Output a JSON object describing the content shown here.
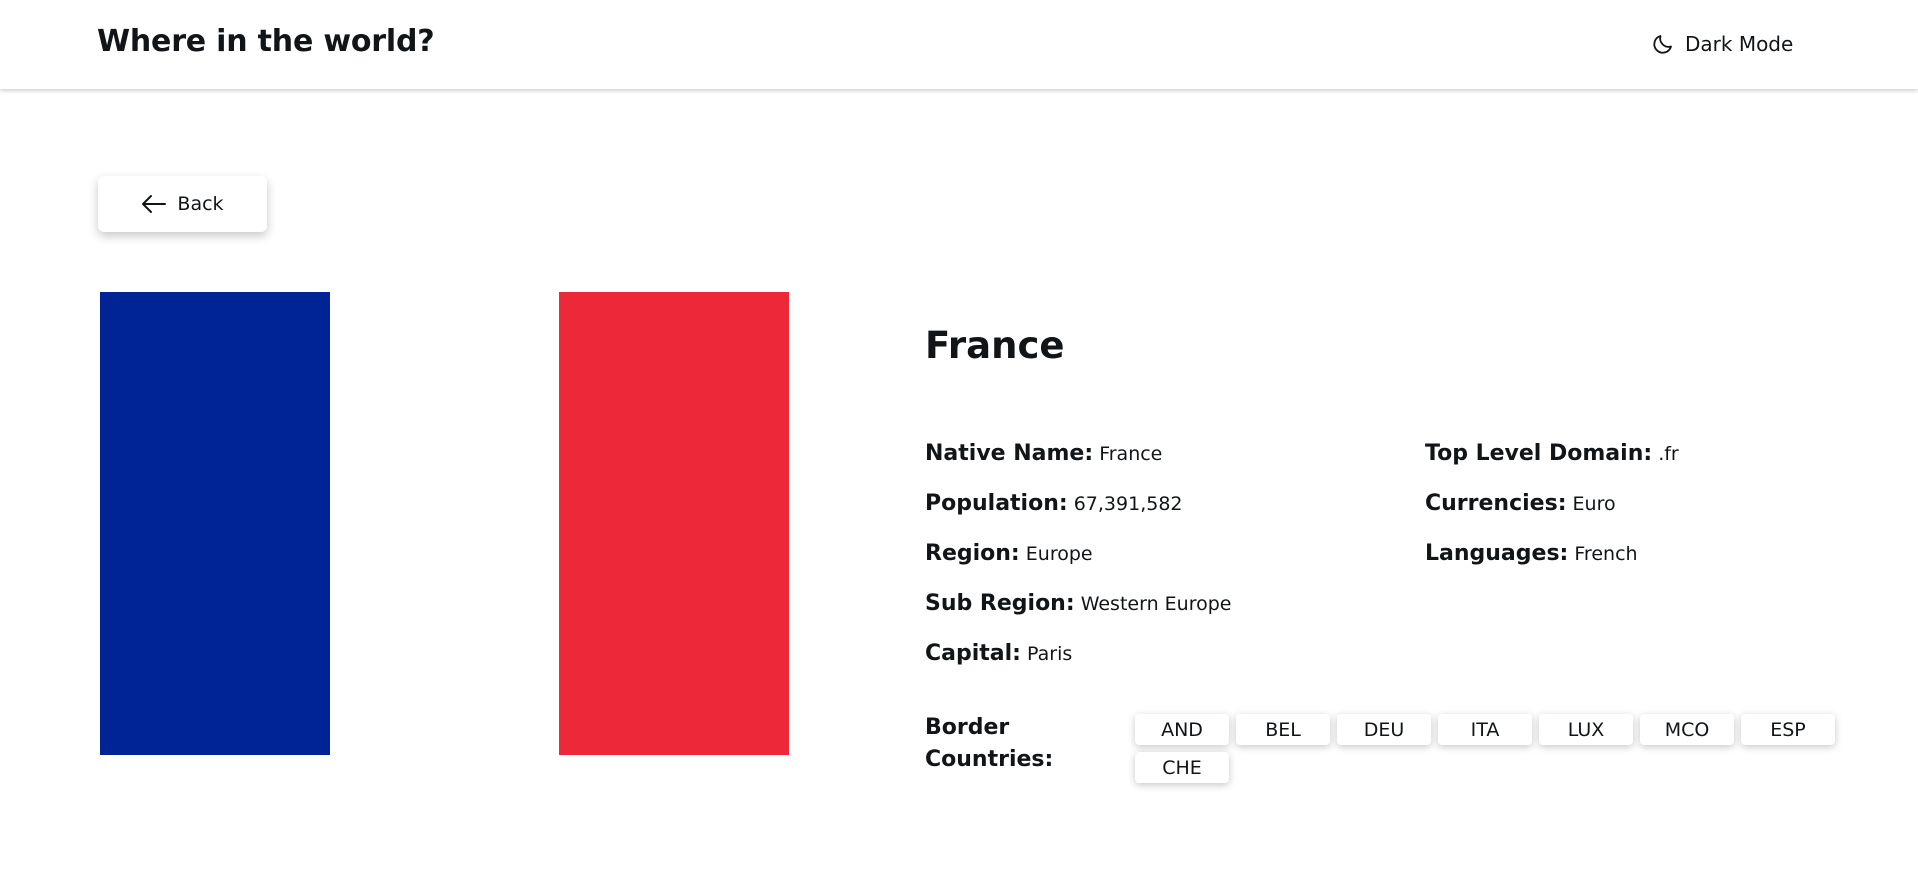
{
  "header": {
    "title": "Where in the world?",
    "theme_toggle_label": "Dark Mode",
    "theme_icon": "moon-icon"
  },
  "back_button": {
    "label": "Back",
    "icon": "arrow-left-icon"
  },
  "flag": {
    "colors": [
      "#002395",
      "#ffffff",
      "#ED2939"
    ]
  },
  "country": {
    "name": "France",
    "left_details": [
      {
        "label": "Native Name:",
        "value": "France"
      },
      {
        "label": "Population:",
        "value": "67,391,582"
      },
      {
        "label": "Region:",
        "value": "Europe"
      },
      {
        "label": "Sub Region:",
        "value": "Western Europe"
      },
      {
        "label": "Capital:",
        "value": "Paris"
      }
    ],
    "right_details": [
      {
        "label": "Top Level Domain:",
        "value": ".fr"
      },
      {
        "label": "Currencies:",
        "value": "Euro"
      },
      {
        "label": "Languages:",
        "value": "French"
      }
    ],
    "border_label": "Border Countries:",
    "borders": [
      "AND",
      "BEL",
      "DEU",
      "ITA",
      "LUX",
      "MCO",
      "ESP",
      "CHE"
    ]
  }
}
